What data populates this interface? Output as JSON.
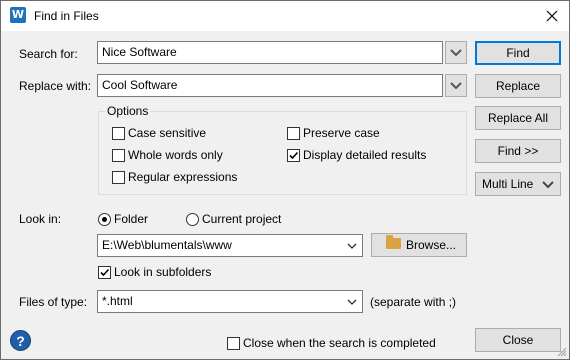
{
  "window": {
    "title": "Find in Files",
    "app_icon": "W"
  },
  "labels": {
    "search_for": "Search for:",
    "replace_with": "Replace with:",
    "options": "Options",
    "look_in": "Look in:",
    "files_of_type": "Files of type:",
    "separate_hint": "(separate with ;)"
  },
  "inputs": {
    "search_value": "Nice Software",
    "replace_value": "Cool Software",
    "folder_path": "E:\\Web\\blumentals\\www",
    "file_types": "*.html"
  },
  "options": {
    "case_sensitive": {
      "label": "Case sensitive",
      "checked": false
    },
    "whole_words": {
      "label": "Whole words only",
      "checked": false
    },
    "regex": {
      "label": "Regular expressions",
      "checked": false
    },
    "preserve_case": {
      "label": "Preserve case",
      "checked": false
    },
    "detailed_results": {
      "label": "Display detailed results",
      "checked": true
    }
  },
  "look_in": {
    "folder": {
      "label": "Folder",
      "selected": true
    },
    "current_project": {
      "label": "Current project",
      "selected": false
    },
    "subfolders": {
      "label": "Look in subfolders",
      "checked": true
    }
  },
  "buttons": {
    "find": "Find",
    "replace": "Replace",
    "replace_all": "Replace All",
    "find_more": "Find >>",
    "multi_line": "Multi Line",
    "browse": "Browse...",
    "close": "Close"
  },
  "footer": {
    "close_when_done": {
      "label": "Close when the search is completed",
      "checked": false
    }
  },
  "colors": {
    "accent": "#0078d7",
    "dialog_bg": "#f0f0f0",
    "help_icon": "#1f5fa8"
  }
}
